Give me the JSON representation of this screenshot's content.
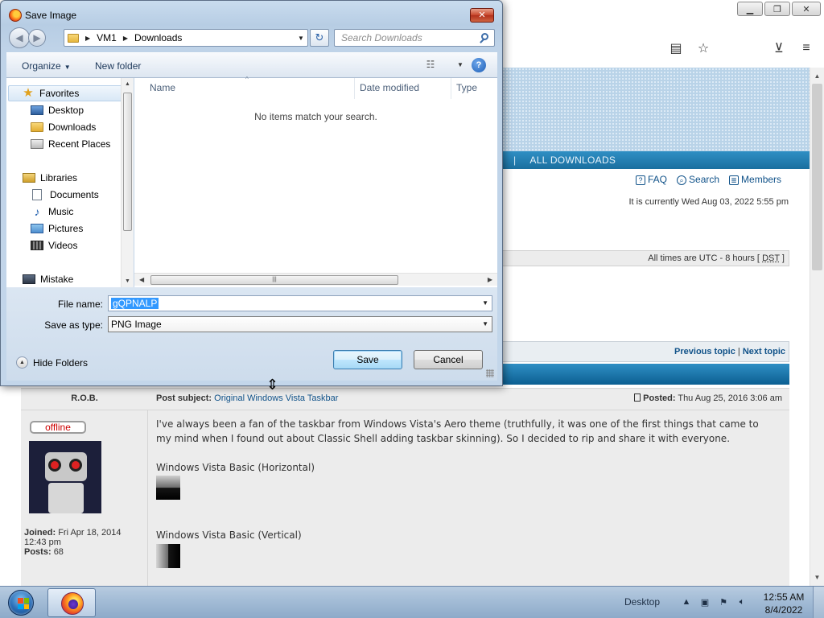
{
  "dialog": {
    "title": "Save Image",
    "close_label": "✕",
    "breadcrumb": [
      "VM1",
      "Downloads"
    ],
    "search_placeholder": "Search Downloads",
    "organize_label": "Organize",
    "new_folder_label": "New folder",
    "help_label": "?",
    "nav": {
      "favorites_label": "Favorites",
      "favorites": [
        "Desktop",
        "Downloads",
        "Recent Places"
      ],
      "libraries_label": "Libraries",
      "libraries": [
        "Documents",
        "Music",
        "Pictures",
        "Videos"
      ],
      "computer_label": "Mistake"
    },
    "columns": [
      "Name",
      "Date modified",
      "Type"
    ],
    "empty_message": "No items match your search.",
    "file_name_label": "File name:",
    "file_name_value": "gQPNALP",
    "save_as_type_label": "Save as type:",
    "save_as_type_value": "PNG Image",
    "hide_folders_label": "Hide Folders",
    "save_label": "Save",
    "cancel_label": "Cancel"
  },
  "forum": {
    "nav_link": "ALL DOWNLOADS",
    "nav_sep": "|",
    "quick_links": [
      "FAQ",
      "Search",
      "Members"
    ],
    "current_time": "It is currently Wed Aug 03, 2022 5:55 pm",
    "timezone_prefix": "All times are UTC - 8 hours [ ",
    "timezone_dst": "DST",
    "timezone_suffix": " ]",
    "previous_topic": "Previous topic",
    "topic_nav_sep": "|",
    "next_topic": "Next topic",
    "author": "R.O.B.",
    "subject_label": "Post subject:",
    "subject": "Original Windows Vista Taskbar",
    "posted_label": "Posted:",
    "posted_date": "Thu Aug 25, 2016 3:06 am",
    "status_badge": "offline",
    "joined_label": "Joined:",
    "joined_value": "Fri Apr 18, 2014 12:43 pm",
    "posts_label": "Posts:",
    "posts_value": "68",
    "post_text": "I've always been a fan of the taskbar from Windows Vista's Aero theme (truthfully, it was one of the first things that came to my mind when I found out about Classic Shell adding taskbar skinning). So I decided to rip and share it with everyone.",
    "image_label_1": "Windows Vista Basic (Horizontal)",
    "image_label_2": "Windows Vista Basic (Vertical)"
  },
  "taskbar": {
    "desktop_label": "Desktop",
    "time": "12:55 AM",
    "date": "8/4/2022"
  },
  "colors": {
    "link": "#105289",
    "forum_nav": "#2f8fc4",
    "offline": "#cc0000",
    "selection": "#3399ff"
  }
}
